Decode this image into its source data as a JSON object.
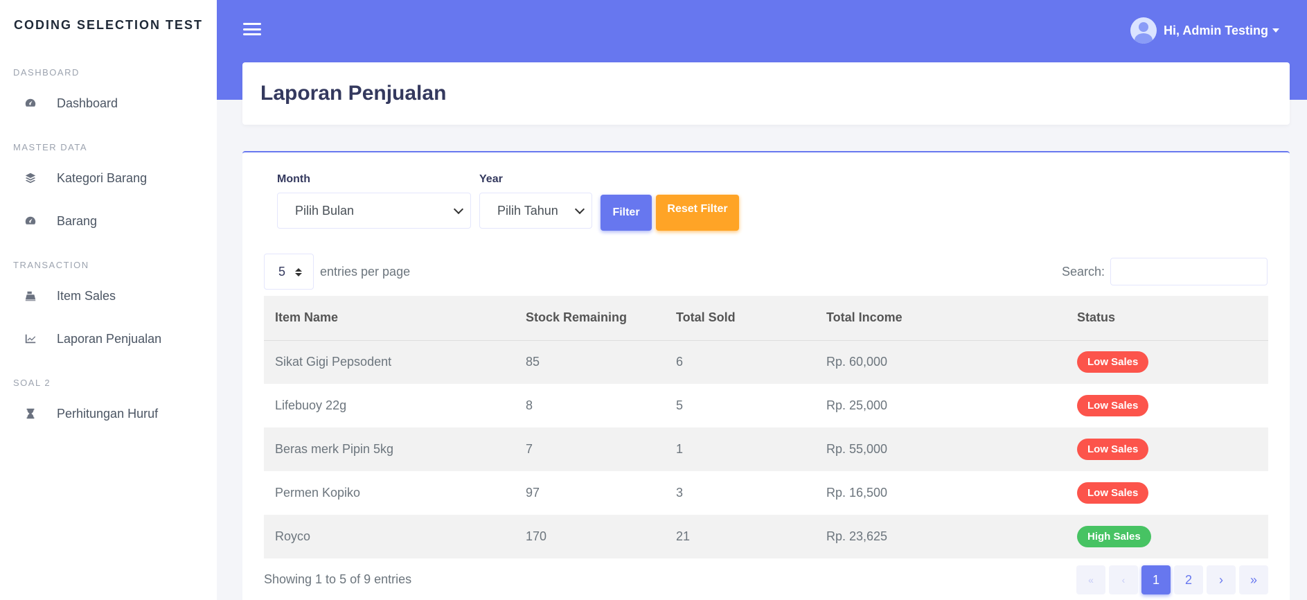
{
  "brand": "CODING SELECTION TEST",
  "sidebar": {
    "sections": [
      {
        "heading": "DASHBOARD",
        "items": [
          {
            "label": "Dashboard",
            "icon": "gauge-icon"
          }
        ]
      },
      {
        "heading": "MASTER DATA",
        "items": [
          {
            "label": "Kategori Barang",
            "icon": "layers-icon"
          },
          {
            "label": "Barang",
            "icon": "gauge-icon"
          }
        ]
      },
      {
        "heading": "TRANSACTION",
        "items": [
          {
            "label": "Item Sales",
            "icon": "cash-register-icon"
          },
          {
            "label": "Laporan Penjualan",
            "icon": "line-chart-icon"
          }
        ]
      },
      {
        "heading": "SOAL 2",
        "items": [
          {
            "label": "Perhitungan Huruf",
            "icon": "hourglass-icon"
          }
        ]
      }
    ]
  },
  "topbar": {
    "user_greeting": "Hi, Admin Testing"
  },
  "page": {
    "title": "Laporan Penjualan"
  },
  "filters": {
    "month_label": "Month",
    "month_value": "Pilih Bulan",
    "year_label": "Year",
    "year_value": "Pilih Tahun",
    "filter_button": "Filter",
    "reset_button": "Reset Filter"
  },
  "table_controls": {
    "entries_value": "5",
    "entries_label": "entries per page",
    "search_label": "Search:",
    "search_value": ""
  },
  "table": {
    "headers": [
      "Item Name",
      "Stock Remaining",
      "Total Sold",
      "Total Income",
      "Status"
    ],
    "rows": [
      {
        "name": "Sikat Gigi Pepsodent",
        "stock": "85",
        "sold": "6",
        "income": "Rp. 60,000",
        "status": "Low Sales"
      },
      {
        "name": "Lifebuoy 22g",
        "stock": "8",
        "sold": "5",
        "income": "Rp. 25,000",
        "status": "Low Sales"
      },
      {
        "name": "Beras merk Pipin 5kg",
        "stock": "7",
        "sold": "1",
        "income": "Rp. 55,000",
        "status": "Low Sales"
      },
      {
        "name": "Permen Kopiko",
        "stock": "97",
        "sold": "3",
        "income": "Rp. 16,500",
        "status": "Low Sales"
      },
      {
        "name": "Royco",
        "stock": "170",
        "sold": "21",
        "income": "Rp. 23,625",
        "status": "High Sales"
      }
    ]
  },
  "footer": {
    "showing": "Showing 1 to 5 of 9 entries",
    "pagination": [
      "«",
      "‹",
      "1",
      "2",
      "›",
      "»"
    ],
    "active_page": "1"
  },
  "colors": {
    "primary": "#6777ef",
    "warning": "#ffa426",
    "danger": "#fc544b",
    "success": "#47c363"
  }
}
